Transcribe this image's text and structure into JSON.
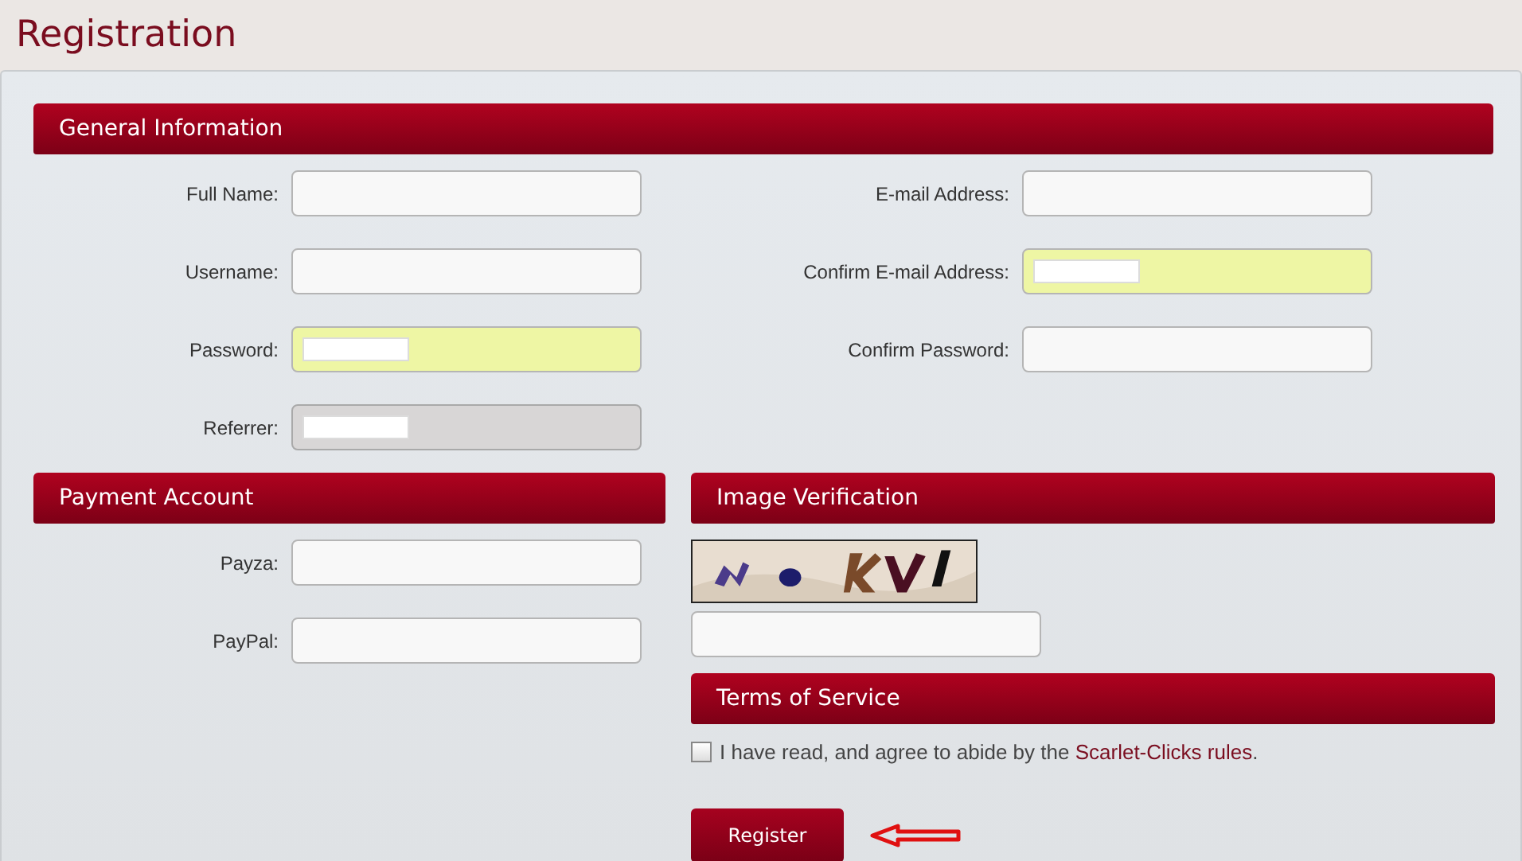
{
  "title": "Registration",
  "general": {
    "heading": "General Information",
    "left": [
      {
        "label": "Full Name:",
        "highlighted": false,
        "disabled": false,
        "masked": false
      },
      {
        "label": "Username:",
        "highlighted": false,
        "disabled": false,
        "masked": false
      },
      {
        "label": "Password:",
        "highlighted": true,
        "disabled": false,
        "masked": true
      },
      {
        "label": "Referrer:",
        "highlighted": false,
        "disabled": true,
        "masked": true
      }
    ],
    "right": [
      {
        "label": "E-mail Address:",
        "highlighted": false,
        "disabled": false,
        "masked": false
      },
      {
        "label": "Confirm E-mail Address:",
        "highlighted": true,
        "disabled": false,
        "masked": true
      },
      {
        "label": "Confirm Password:",
        "highlighted": false,
        "disabled": false,
        "masked": false
      }
    ]
  },
  "payment": {
    "heading": "Payment Account",
    "fields": [
      {
        "label": "Payza:",
        "highlighted": false,
        "disabled": false,
        "masked": false
      },
      {
        "label": "PayPal:",
        "highlighted": false,
        "disabled": false,
        "masked": false
      }
    ]
  },
  "verification": {
    "heading": "Image Verification"
  },
  "terms": {
    "heading": "Terms of Service",
    "checked": false,
    "text_before": "I have read, and agree to abide by the ",
    "link": "Scarlet-Clicks rules",
    "text_after": "."
  },
  "register_button": "Register"
}
